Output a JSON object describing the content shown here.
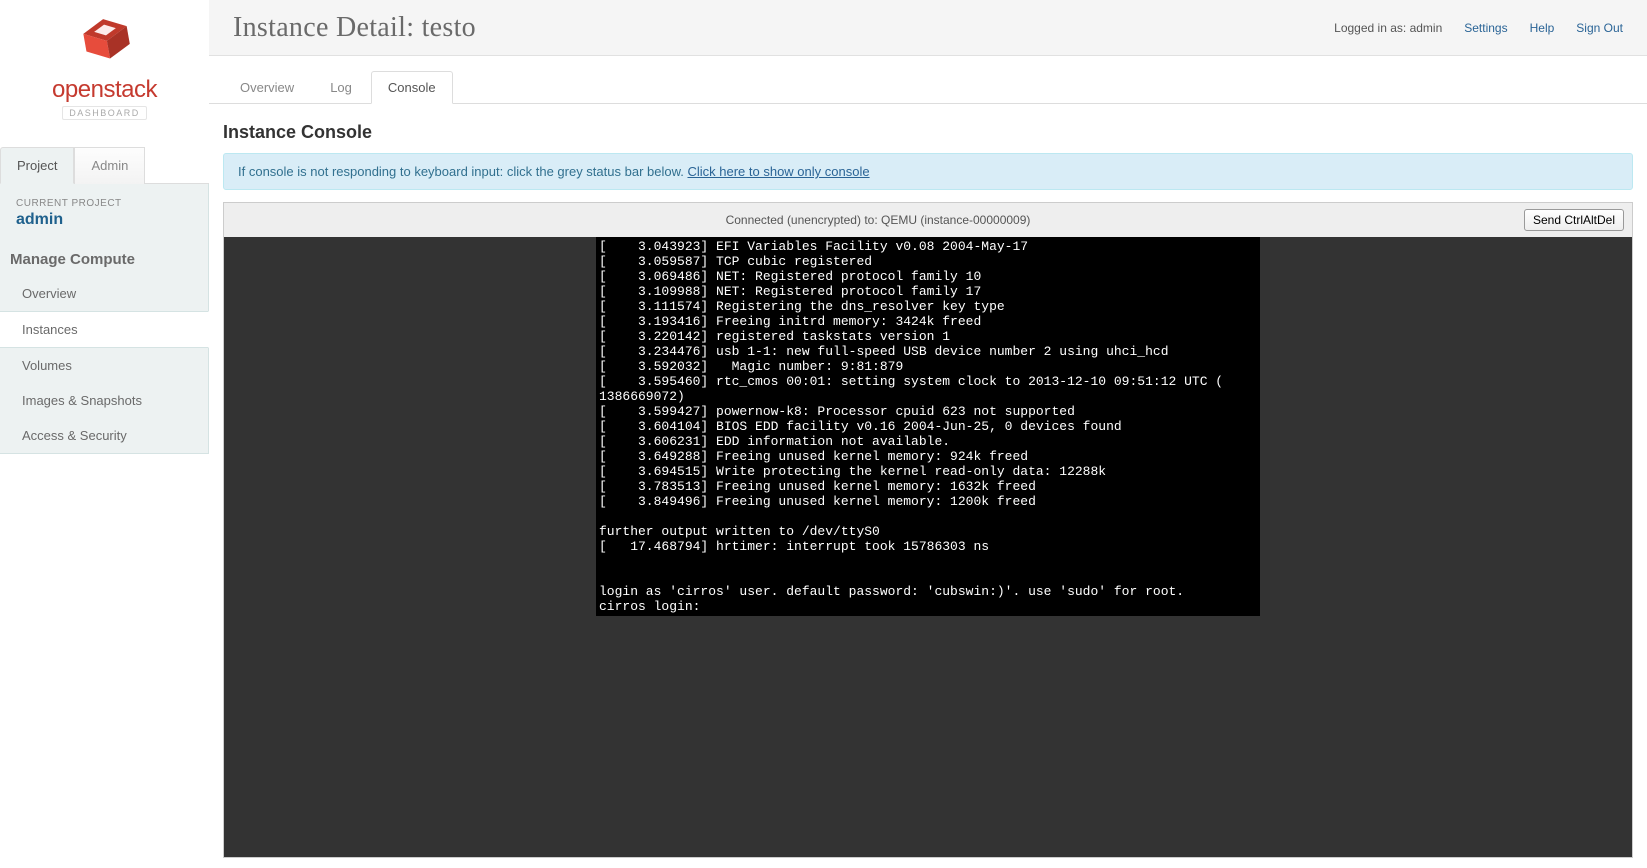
{
  "header": {
    "title_prefix": "Instance Detail: ",
    "title_name": "testo",
    "logged_in_prefix": "Logged in as: ",
    "logged_in_user": "admin",
    "links": {
      "settings": "Settings",
      "help": "Help",
      "signout": "Sign Out"
    }
  },
  "brand": {
    "name": "openstack",
    "subtitle": "DASHBOARD"
  },
  "top_tabs": [
    {
      "label": "Project",
      "active": true
    },
    {
      "label": "Admin",
      "active": false
    }
  ],
  "sidebar": {
    "current_label": "CURRENT PROJECT",
    "current_project": "admin",
    "section": "Manage Compute",
    "items": [
      {
        "label": "Overview",
        "active": false
      },
      {
        "label": "Instances",
        "active": true
      },
      {
        "label": "Volumes",
        "active": false
      },
      {
        "label": "Images & Snapshots",
        "active": false
      },
      {
        "label": "Access & Security",
        "active": false
      }
    ]
  },
  "tabs": [
    {
      "label": "Overview",
      "active": false
    },
    {
      "label": "Log",
      "active": false
    },
    {
      "label": "Console",
      "active": true
    }
  ],
  "console": {
    "heading": "Instance Console",
    "alert_text": "If console is not responding to keyboard input: click the grey status bar below. ",
    "alert_link": "Click here to show only console",
    "status": "Connected (unencrypted) to: QEMU (instance-00000009)",
    "send_cad": "Send CtrlAltDel",
    "output_lines": [
      "[    3.043923] EFI Variables Facility v0.08 2004-May-17",
      "[    3.059587] TCP cubic registered",
      "[    3.069486] NET: Registered protocol family 10",
      "[    3.109988] NET: Registered protocol family 17",
      "[    3.111574] Registering the dns_resolver key type",
      "[    3.193416] Freeing initrd memory: 3424k freed",
      "[    3.220142] registered taskstats version 1",
      "[    3.234476] usb 1-1: new full-speed USB device number 2 using uhci_hcd",
      "[    3.592032]   Magic number: 9:81:879",
      "[    3.595460] rtc_cmos 00:01: setting system clock to 2013-12-10 09:51:12 UTC (",
      "1386669072)",
      "[    3.599427] powernow-k8: Processor cpuid 623 not supported",
      "[    3.604104] BIOS EDD facility v0.16 2004-Jun-25, 0 devices found",
      "[    3.606231] EDD information not available.",
      "[    3.649288] Freeing unused kernel memory: 924k freed",
      "[    3.694515] Write protecting the kernel read-only data: 12288k",
      "[    3.783513] Freeing unused kernel memory: 1632k freed",
      "[    3.849496] Freeing unused kernel memory: 1200k freed",
      "",
      "further output written to /dev/ttyS0",
      "[   17.468794] hrtimer: interrupt took 15786303 ns",
      "",
      "",
      "login as 'cirros' user. default password: 'cubswin:)'. use 'sudo' for root.",
      "cirros login:"
    ]
  }
}
